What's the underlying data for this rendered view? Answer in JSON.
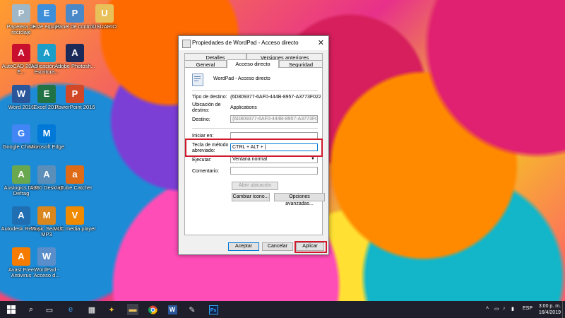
{
  "desktop_icons": [
    {
      "label": "Papelera de reciclaje",
      "icon": "recycle-bin-icon",
      "color": "#9fb7c7"
    },
    {
      "label": "Este equipo",
      "icon": "computer-icon",
      "color": "#3d8fd9"
    },
    {
      "label": "Panel de control",
      "icon": "control-panel-icon",
      "color": "#4a88c8"
    },
    {
      "label": "USUARIO",
      "icon": "folder-icon",
      "color": "#e8c15b"
    },
    {
      "label": "AutoCAD 2018 - E...",
      "icon": "autocad-icon",
      "color": "#c8102e"
    },
    {
      "label": "Aplicación de escritora...",
      "icon": "autodesk-app-icon",
      "color": "#1c9ec9"
    },
    {
      "label": "Adobe Photosh...",
      "icon": "photoshop-icon",
      "color": "#1c2a5a"
    },
    {
      "label": "Word 2016",
      "icon": "word-icon",
      "color": "#2b579a"
    },
    {
      "label": "Excel 2016",
      "icon": "excel-icon",
      "color": "#217346"
    },
    {
      "label": "PowerPoint 2016",
      "icon": "powerpoint-icon",
      "color": "#d24726"
    },
    {
      "label": "Google Chrome",
      "icon": "chrome-icon",
      "color": "#4285f4"
    },
    {
      "label": "Microsoft Edge",
      "icon": "edge-icon",
      "color": "#0078d7"
    },
    {
      "label": "Auslogics Disk Defrag",
      "icon": "defrag-icon",
      "color": "#6aa84f"
    },
    {
      "label": "A360 Desktop",
      "icon": "a360-icon",
      "color": "#5b8fb9"
    },
    {
      "label": "aTube Catcher",
      "icon": "atube-icon",
      "color": "#e06b17"
    },
    {
      "label": "Autodesk ReCap",
      "icon": "recap-icon",
      "color": "#1f6fb2"
    },
    {
      "label": "Music Search MP3",
      "icon": "music-search-icon",
      "color": "#d9861c"
    },
    {
      "label": "VLC media player",
      "icon": "vlc-icon",
      "color": "#f08a00"
    },
    {
      "label": "Avast Free Antivirus",
      "icon": "avast-icon",
      "color": "#f57c00"
    },
    {
      "label": "WordPad - Acceso d...",
      "icon": "wordpad-icon",
      "color": "#5a8ecb"
    }
  ],
  "dialog": {
    "title": "Propiedades de WordPad - Acceso directo",
    "tabs_row1": [
      "Detalles",
      "Versiones anteriores"
    ],
    "tabs_row2": [
      "General",
      "Acceso directo",
      "Seguridad"
    ],
    "header_name": "WordPad - Acceso directo",
    "fields": {
      "target_type_label": "Tipo de destino:",
      "target_type_value": "{6D809377-6AF0-444B-8957-A3773F02200E}\\W",
      "target_location_label": "Ubicación de destino:",
      "target_location_value": "Applications",
      "target_label": "Destino:",
      "target_value": "{6D809377-6AF0-444B-8957-A3773F02200E}\\",
      "start_in_label": "Iniciar en:",
      "start_in_value": "",
      "shortcut_key_label": "Tecla de método abreviado:",
      "shortcut_key_value": "CTRL + ALT + |",
      "run_label": "Ejecutar:",
      "run_value": "Ventana normal",
      "comment_label": "Comentario:",
      "comment_value": ""
    },
    "buttons": {
      "open_location": "Abrir ubicación",
      "change_icon": "Cambiar icono...",
      "advanced": "Opciones avanzadas...",
      "ok": "Aceptar",
      "cancel": "Cancelar",
      "apply": "Aplicar"
    },
    "highlight_color": "#d0192c"
  },
  "taskbar": {
    "apps": [
      "start-icon",
      "search-icon",
      "task-view-icon",
      "edge-icon",
      "store-icon",
      "python-icon",
      "file-explorer-icon",
      "chrome-icon",
      "word-icon",
      "paint-icon",
      "photoshop-icon"
    ],
    "tray_lang": "ESP",
    "time": "3:00 p. m.",
    "date": "16/4/2019"
  }
}
